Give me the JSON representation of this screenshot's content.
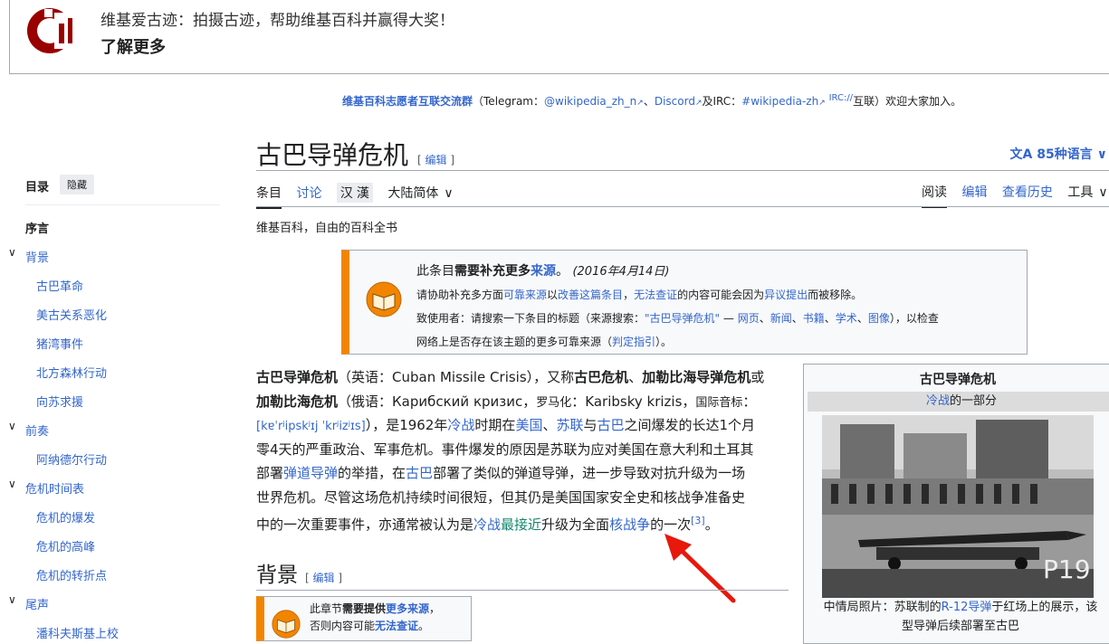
{
  "banner": {
    "line1": "维基爱古迹：拍摄古迹，帮助维基百科并赢得大奖！",
    "line2": "了解更多"
  },
  "notice": {
    "group": "维基百科志愿者互联交流群",
    "p1": "（Telegram：",
    "telegram": "@wikipedia_zh_n",
    "p2": "、",
    "discord": "Discord",
    "p3": "及IRC：",
    "irc": "#wikipedia-zh",
    "irc_sup": "IRC://",
    "p4": "互联）欢迎大家加入。"
  },
  "toc": {
    "heading": "目录",
    "hide": "隐藏",
    "items": [
      {
        "label": "序言"
      },
      {
        "label": "背景"
      },
      {
        "label": "古巴革命"
      },
      {
        "label": "美古关系恶化"
      },
      {
        "label": "猪湾事件"
      },
      {
        "label": "北方森林行动"
      },
      {
        "label": "向苏求援"
      },
      {
        "label": "前奏"
      },
      {
        "label": "阿纳德尔行动"
      },
      {
        "label": "危机时间表"
      },
      {
        "label": "危机的爆发"
      },
      {
        "label": "危机的高峰"
      },
      {
        "label": "危机的转折点"
      },
      {
        "label": "尾声"
      },
      {
        "label": "潘科夫斯基上校"
      }
    ]
  },
  "article": {
    "title": "古巴导弹危机",
    "edit": "编辑",
    "languages": "85种语言",
    "tabs": {
      "article": "条目",
      "talk": "讨论",
      "han1": "汉",
      "han2": "漢",
      "variant": "大陆简体"
    },
    "rtabs": {
      "read": "阅读",
      "edit": "编辑",
      "history": "查看历史",
      "tools": "工具"
    },
    "tagline": "维基百科，自由的百科全书"
  },
  "ambox": {
    "t1": "此条目",
    "t2": "需要补充更多",
    "t3": "来源",
    "t4": "。",
    "date": "(2016年4月14日)",
    "l2a": "请协助补充多方面",
    "l2b": "可靠来源",
    "l2c": "以",
    "l2d": "改善这篇条目",
    "l2e": "，",
    "l2f": "无法查证",
    "l2g": "的内容可能会因为",
    "l2h": "异议提出",
    "l2i": "而被移除。",
    "l3a": "致使用者：请搜索一下条目的标题（来源搜索：",
    "l3b": "\"古巴导弹危机\"",
    "l3c": " — ",
    "l3d": "网页",
    "l3e": "、",
    "l3f": "新闻",
    "l3g": "、",
    "l3h": "书籍",
    "l3i": "、",
    "l3j": "学术",
    "l3k": "、",
    "l3l": "图像",
    "l3m": "），以检查",
    "l4a": "网络上是否存在该主题的更多可靠来源（",
    "l4b": "判定指引",
    "l4c": "）。"
  },
  "para": {
    "a1": "古巴导弹危机",
    "a2": "（英语：Cuban Missile Crisis），又称",
    "a3": "古巴危机",
    "a4": "、",
    "a5": "加勒比海导弹危机",
    "a6": "或",
    "b1": "加勒比海危机",
    "b2": "（俄语：Карибский кризис，",
    "b3": "罗马化",
    "b4": "：Karibsky krizis，",
    "b5": "国际音标",
    "b6": "：",
    "c1": "[kɐˈrʲipskʲɪj ˈkrʲizʲɪs]",
    "c2": "），是1962年",
    "c3": "冷战",
    "c4": "时期在",
    "c5": "美国",
    "c6": "、",
    "c7": "苏联",
    "c8": "与",
    "c9": "古巴",
    "c10": "之间爆发的长达1个月",
    "d1": "零4天的严重政治、军事危机。事件爆发的原因是苏联为应对美国在意大利和土耳其",
    "e1": "部署",
    "e2": "弹道导弹",
    "e3": "的举措，在",
    "e4": "古巴",
    "e5": "部署了类似的弹道导弹，进一步导致对抗升级为一场",
    "f1": "世界危机。尽管这场危机持续时间很短，但其仍是美国国家安全史和核战争准备史",
    "g1": "中的一次重要事件，亦通常被认为是",
    "g2": "冷战",
    "g3": "最接近",
    "g4": "升级为全面",
    "g5": "核战争",
    "g6": "的一次",
    "g7": "[3]",
    "g8": "。"
  },
  "section": {
    "title": "背景",
    "edit": "编辑",
    "box_l1a": "此章节",
    "box_l1b": "需要提供",
    "box_l1c": "更多来源",
    "box_l1d": "，",
    "box_l2a": "否则内容可能",
    "box_l2b": "无法查证",
    "box_l2c": "。"
  },
  "infobox": {
    "title": "古巴导弹危机",
    "part_link": "冷战",
    "part_text": "的一部分",
    "caption1": "中情局照片：苏联制的",
    "caption_link": "R-12导弹",
    "caption2": "于红场上的展示，该",
    "caption3": "型导弹后续部署至古巴"
  }
}
